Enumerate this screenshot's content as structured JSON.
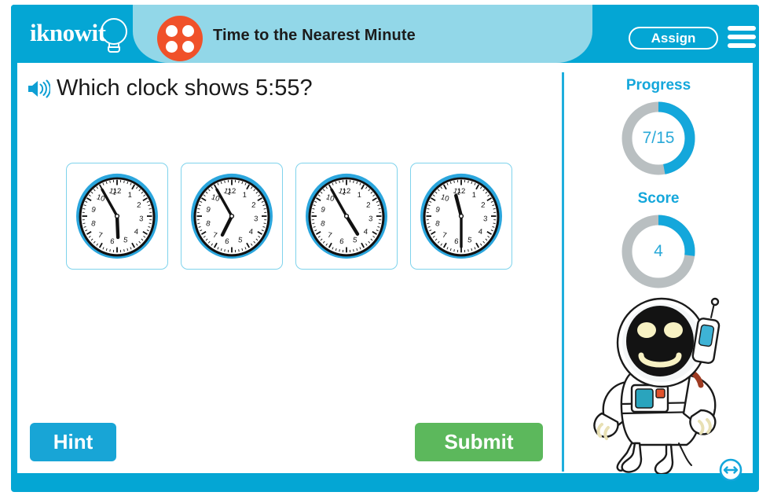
{
  "app": {
    "logo_text": "iknowit",
    "logo_icon": "lightbulb-icon"
  },
  "header": {
    "topic_title": "Time to the Nearest Minute",
    "topic_badge_icon": "four-dots-circle-icon",
    "assign_label": "Assign",
    "menu_icon": "hamburger-menu-icon",
    "bg_color": "#04a6d4",
    "pill_color": "#92d7e8",
    "badge_color": "#f0512a"
  },
  "question": {
    "audio_icon": "speaker-icon",
    "text": "Which clock shows 5:55?"
  },
  "choices": [
    {
      "id": "choice-a",
      "icon": "analog-clock-icon",
      "hour": 5,
      "minute": 55,
      "label": "5:55"
    },
    {
      "id": "choice-b",
      "icon": "analog-clock-icon",
      "hour": 6,
      "minute": 55,
      "label": "6:55"
    },
    {
      "id": "choice-c",
      "icon": "analog-clock-icon",
      "hour": 4,
      "minute": 55,
      "label": "4:55"
    },
    {
      "id": "choice-d",
      "icon": "analog-clock-icon",
      "hour": 11,
      "minute": 30,
      "label": "11:30"
    }
  ],
  "clock_numerals": [
    "12",
    "1",
    "2",
    "3",
    "4",
    "5",
    "6",
    "7",
    "8",
    "9",
    "10",
    "11"
  ],
  "rail": {
    "progress": {
      "label": "Progress",
      "value": "7/15",
      "current": 7,
      "total": 15,
      "percent": 47,
      "arc_color": "#14a7db",
      "track_color": "#b9bfc1"
    },
    "score": {
      "label": "Score",
      "value": "4",
      "current": 4,
      "percent": 27,
      "arc_color": "#14a7db",
      "track_color": "#b9bfc1"
    },
    "mascot_icon": "astronaut-robot-mascot"
  },
  "actions": {
    "hint_label": "Hint",
    "hint_color": "#18a5d6",
    "submit_label": "Submit",
    "submit_color": "#5cb85c",
    "resize_icon": "resize-horizontal-icon"
  }
}
